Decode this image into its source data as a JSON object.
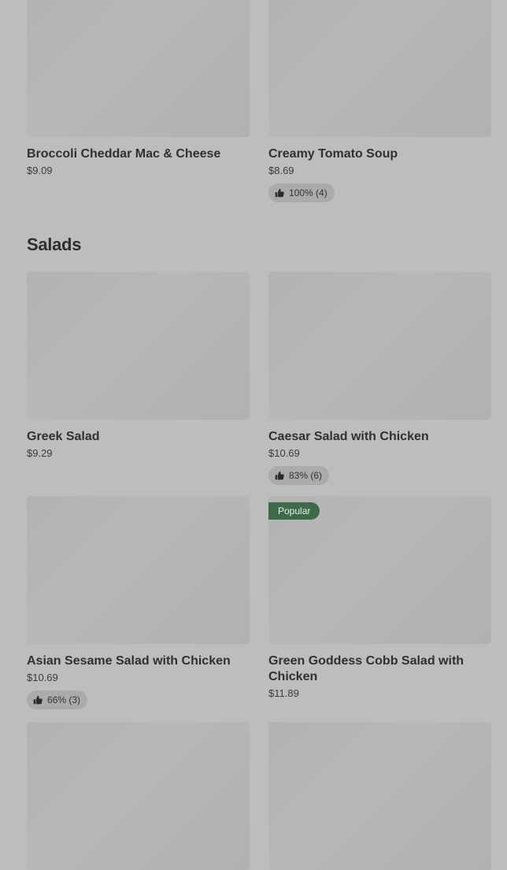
{
  "top_cards": [
    {
      "name": "Broccoli Cheddar Mac & Cheese",
      "price": "$9.09"
    },
    {
      "name": "Creamy Tomato Soup",
      "price": "$8.69",
      "rating": "100% (4)"
    }
  ],
  "salads_section": {
    "title": "Salads",
    "items": [
      {
        "name": "Greek Salad",
        "price": "$9.29"
      },
      {
        "name": "Caesar Salad with Chicken",
        "price": "$10.69",
        "rating": "83% (6)"
      },
      {
        "name": "Asian Sesame Salad with Chicken",
        "price": "$10.69",
        "rating": "66% (3)"
      },
      {
        "name": "Green Goddess Cobb Salad with Chicken",
        "price": "$11.89",
        "badge": "Popular"
      }
    ]
  },
  "colors": {
    "badge_bg": "#3d6b4a",
    "overlay": "#bdbdbd"
  }
}
